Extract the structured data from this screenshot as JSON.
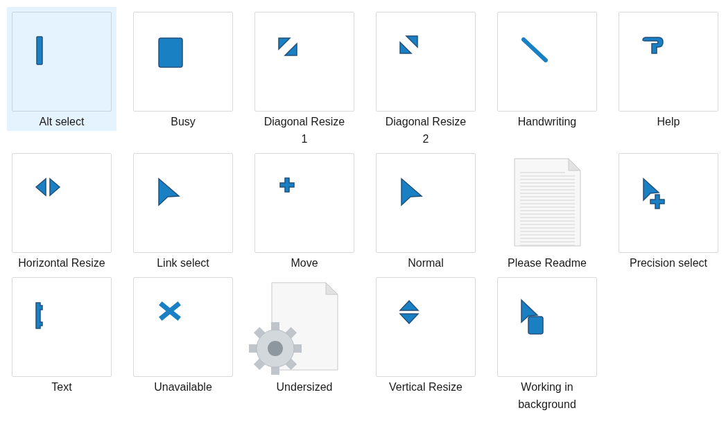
{
  "items": [
    {
      "label": "Alt select",
      "kind": "beam",
      "selected": true
    },
    {
      "label": "Busy",
      "kind": "busy",
      "selected": false
    },
    {
      "label": "Diagonal Resize 1",
      "kind": "diag1",
      "selected": false
    },
    {
      "label": "Diagonal Resize 2",
      "kind": "diag2",
      "selected": false
    },
    {
      "label": "Handwriting",
      "kind": "pen",
      "selected": false
    },
    {
      "label": "Help",
      "kind": "help",
      "selected": false
    },
    {
      "label": "Horizontal Resize",
      "kind": "hresize",
      "selected": false
    },
    {
      "label": "Link select",
      "kind": "arrow",
      "selected": false
    },
    {
      "label": "Move",
      "kind": "move",
      "selected": false
    },
    {
      "label": "Normal",
      "kind": "arrow",
      "selected": false
    },
    {
      "label": "Please Readme",
      "kind": "document",
      "selected": false
    },
    {
      "label": "Precision select",
      "kind": "precision",
      "selected": false
    },
    {
      "label": "Text",
      "kind": "text",
      "selected": false
    },
    {
      "label": "Unavailable",
      "kind": "unavailable",
      "selected": false
    },
    {
      "label": "Undersized",
      "kind": "settings",
      "selected": false
    },
    {
      "label": "Vertical Resize",
      "kind": "vresize",
      "selected": false
    },
    {
      "label": "Working in background",
      "kind": "working",
      "selected": false
    }
  ]
}
